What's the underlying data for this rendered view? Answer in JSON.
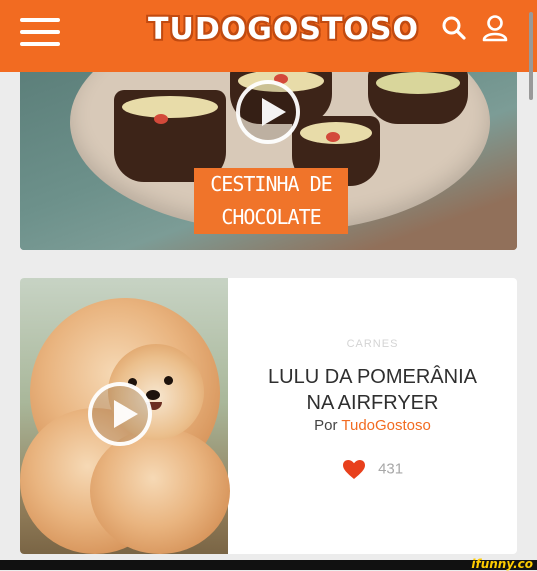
{
  "header": {
    "logo_text": "TUDOGOSTOSO",
    "brand_color": "#f26b21",
    "icons": [
      "menu-icon",
      "search-icon",
      "user-icon"
    ]
  },
  "featured": {
    "label_line1": "CESTINHA DE",
    "label_line2": "CHOCOLATE",
    "play_icon": "play-icon"
  },
  "recipe": {
    "category": "CARNES",
    "title_line1": "LULU DA POMERÂNIA",
    "title_line2": "NA AIRFRYER",
    "author_prefix": "Por",
    "author_name": "TudoGostoso",
    "likes": "431",
    "like_icon": "heart-icon",
    "heart_color": "#e8401c"
  },
  "watermark": "ifunny.co"
}
